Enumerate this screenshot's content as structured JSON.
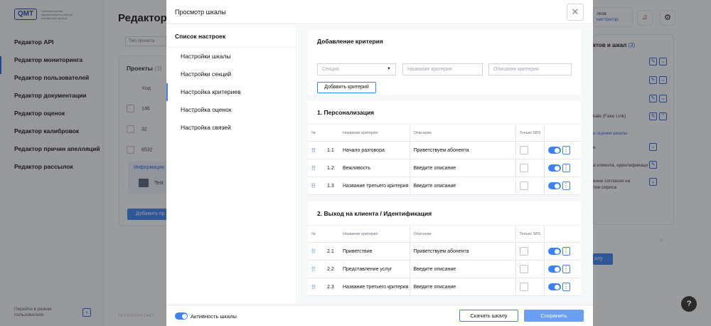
{
  "background": {
    "sidebar": {
      "logo_text": "QMT",
      "logo_subtitle": "Система оценки эффективности работы контактного центра",
      "items": [
        "Редактор API",
        "Редактор мониторинга",
        "Редактор пользователей",
        "Редактор документации",
        "Редактор оценок",
        "Редактор калибровок",
        "Редактор причин апелляций",
        "Редактор рассылок"
      ],
      "active_index": 1,
      "bottom_text": "Перейти в режим пользователя"
    },
    "page_title": "Редактор м",
    "project_input_placeholder": "Тип проекта",
    "projects_label": "Проекты",
    "projects_count": "(3)",
    "code_header": "Код",
    "codes": [
      "146",
      "32",
      "6532"
    ],
    "info_label": "Информация",
    "info_item": "Test",
    "add_button": "Добавить пр",
    "footer_text": "ТЕХНОКОНТАКТ",
    "user": {
      "name": "лков",
      "role": "нистратор"
    },
    "right_panel": {
      "title": "ктов и шкал",
      "count": "(3)",
      "row_text": "kale (Fake Link)",
      "link_text": "и оценки шкалы",
      "sub_rows": [
        "е",
        "а клиента, идентификаци",
        "ение согласия на",
        "тие опроса"
      ],
      "button_label": "алу"
    }
  },
  "modal": {
    "title": "Просмотр шкалы",
    "close_icon": "close-icon",
    "nav_title": "Список настроек",
    "nav_items": [
      "Настройки шкалы",
      "Настройки секций",
      "Настройка критериев",
      "Настройка оценок",
      "Настройка связей"
    ],
    "nav_active_index": 2,
    "add_criterion": {
      "title": "Добавление критерия",
      "section_placeholder": "Секция",
      "name_placeholder": "Название критерия",
      "description_placeholder": "Описание критерия",
      "add_button": "Добавить критерий"
    },
    "table_headers": {
      "num": "№",
      "name": "Название критерия",
      "description": "Описание",
      "sbs_only": "Только SBS"
    },
    "description_placeholder": "Введите описание",
    "sections": [
      {
        "title": "1. Персонализация",
        "rows": [
          {
            "num": "1.1",
            "name": "Начало разговора",
            "description": "Приветствуем абонента",
            "sbs": false,
            "active": true
          },
          {
            "num": "1.2",
            "name": "Вежливость",
            "description": "",
            "sbs": false,
            "active": true
          },
          {
            "num": "1.3",
            "name": "Название третьего критерия",
            "description": "",
            "sbs": false,
            "active": true
          }
        ]
      },
      {
        "title": "2. Выход на клиента / Идентификация",
        "rows": [
          {
            "num": "2.1",
            "name": "Приветствие",
            "description": "Приветствуем абонента",
            "sbs": false,
            "active": true
          },
          {
            "num": "2.2",
            "name": "Представление услуг",
            "description": "",
            "sbs": false,
            "active": true
          },
          {
            "num": "2.3",
            "name": "Название третьего критерия",
            "description": "",
            "sbs": false,
            "active": true
          }
        ]
      }
    ],
    "footer": {
      "active_label": "Активность шкалы",
      "active": true,
      "download_button": "Скачать шкалу",
      "save_button": "Сохранить"
    }
  },
  "help_icon_label": "?",
  "colors": {
    "accent": "#3b82f6",
    "save_button": "#6b9ff5",
    "overlay": "rgba(35,38,42,0.46)"
  }
}
